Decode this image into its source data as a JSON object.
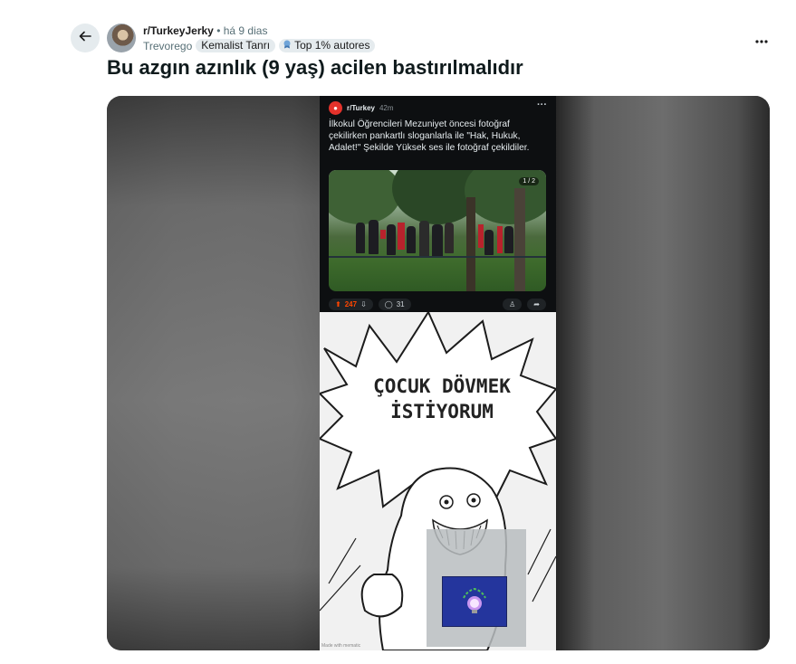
{
  "post": {
    "subreddit": "r/TurkeyJerky",
    "time": "há 9 dias",
    "username": "Trevorego",
    "flair": "Kemalist Tanrı",
    "achievement": "Top 1% autores",
    "title": "Bu azgın azınlık (9 yaş) acilen bastırılmalıdır"
  },
  "embedded": {
    "subreddit": "r/Turkey",
    "time": "42m",
    "text": "İlkokul Öğrencileri Mezuniyet öncesi fotoğraf çekilirken pankartlı sloganlarla ile \"Hak, Hukuk, Adalet!\" Şekilde Yüksek ses ile fotoğraf çekildiler.",
    "image_counter": "1 / 2",
    "upvotes": "247",
    "comments": "31"
  },
  "meme": {
    "line1": "ÇOCUK DÖVMEK",
    "line2": "İSTİYORUM",
    "credit": "Made with mematic"
  },
  "icons": {
    "back": "arrow-left-icon",
    "more": "more-horizontal-icon",
    "achievement": "achievement-badge-icon"
  },
  "colors": {
    "upvote": "#ff4500",
    "flag_blue": "#24359d"
  }
}
